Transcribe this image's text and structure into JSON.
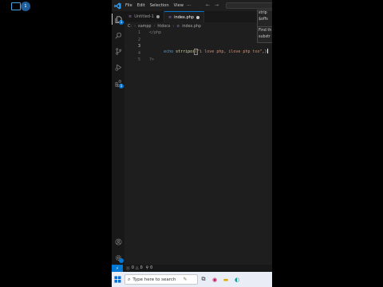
{
  "menu": [
    "File",
    "Edit",
    "Selection",
    "View"
  ],
  "menu_more": "···",
  "nav": {
    "back": "←",
    "forward": "→"
  },
  "tabs": [
    {
      "label": "Untitled-1",
      "active": false
    },
    {
      "label": "index.php",
      "active": true
    }
  ],
  "breadcrumb": [
    "C:",
    "xampp",
    "htdocs",
    "index.php"
  ],
  "badges": {
    "explorer": "1",
    "extensions": "1",
    "webcam": "1"
  },
  "code": {
    "lines": [
      {
        "num": "1",
        "text": "</php"
      },
      {
        "num": "2",
        "text": ""
      },
      {
        "num": "3",
        "kw": "echo",
        "fn": "strripos",
        "open": "(",
        "str": "\"i love php, ilove php too\"",
        "tail": ",)"
      },
      {
        "num": "4",
        "text": ""
      },
      {
        "num": "5",
        "text": "?>"
      }
    ]
  },
  "popup": {
    "lines": [
      "strip",
      "$offs",
      "Find th",
      "substr"
    ]
  },
  "status": {
    "errors": "0",
    "warnings": "0",
    "ports": "0"
  },
  "taskbar": {
    "search_placeholder": "Type here to search"
  },
  "colors": {
    "accent": "#0078d4",
    "editor_bg": "#1e1e1e",
    "string": "#ce9178",
    "keyword": "#569cd6",
    "function": "#dcdcaa"
  }
}
